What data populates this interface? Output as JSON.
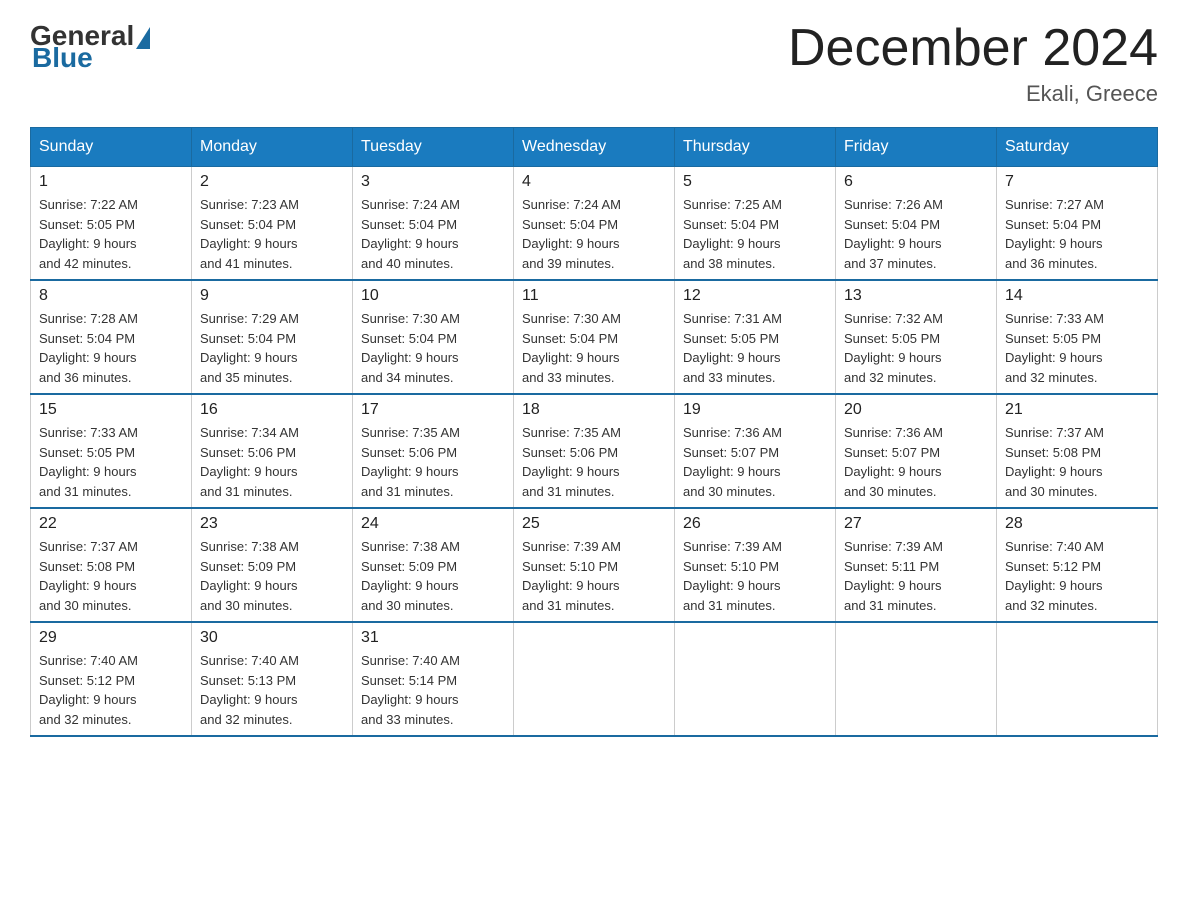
{
  "header": {
    "logo_general": "General",
    "logo_blue": "Blue",
    "title": "December 2024",
    "location": "Ekali, Greece"
  },
  "days_of_week": [
    "Sunday",
    "Monday",
    "Tuesday",
    "Wednesday",
    "Thursday",
    "Friday",
    "Saturday"
  ],
  "weeks": [
    [
      {
        "day": "1",
        "sunrise": "7:22 AM",
        "sunset": "5:05 PM",
        "daylight": "9 hours and 42 minutes."
      },
      {
        "day": "2",
        "sunrise": "7:23 AM",
        "sunset": "5:04 PM",
        "daylight": "9 hours and 41 minutes."
      },
      {
        "day": "3",
        "sunrise": "7:24 AM",
        "sunset": "5:04 PM",
        "daylight": "9 hours and 40 minutes."
      },
      {
        "day": "4",
        "sunrise": "7:24 AM",
        "sunset": "5:04 PM",
        "daylight": "9 hours and 39 minutes."
      },
      {
        "day": "5",
        "sunrise": "7:25 AM",
        "sunset": "5:04 PM",
        "daylight": "9 hours and 38 minutes."
      },
      {
        "day": "6",
        "sunrise": "7:26 AM",
        "sunset": "5:04 PM",
        "daylight": "9 hours and 37 minutes."
      },
      {
        "day": "7",
        "sunrise": "7:27 AM",
        "sunset": "5:04 PM",
        "daylight": "9 hours and 36 minutes."
      }
    ],
    [
      {
        "day": "8",
        "sunrise": "7:28 AM",
        "sunset": "5:04 PM",
        "daylight": "9 hours and 36 minutes."
      },
      {
        "day": "9",
        "sunrise": "7:29 AM",
        "sunset": "5:04 PM",
        "daylight": "9 hours and 35 minutes."
      },
      {
        "day": "10",
        "sunrise": "7:30 AM",
        "sunset": "5:04 PM",
        "daylight": "9 hours and 34 minutes."
      },
      {
        "day": "11",
        "sunrise": "7:30 AM",
        "sunset": "5:04 PM",
        "daylight": "9 hours and 33 minutes."
      },
      {
        "day": "12",
        "sunrise": "7:31 AM",
        "sunset": "5:05 PM",
        "daylight": "9 hours and 33 minutes."
      },
      {
        "day": "13",
        "sunrise": "7:32 AM",
        "sunset": "5:05 PM",
        "daylight": "9 hours and 32 minutes."
      },
      {
        "day": "14",
        "sunrise": "7:33 AM",
        "sunset": "5:05 PM",
        "daylight": "9 hours and 32 minutes."
      }
    ],
    [
      {
        "day": "15",
        "sunrise": "7:33 AM",
        "sunset": "5:05 PM",
        "daylight": "9 hours and 31 minutes."
      },
      {
        "day": "16",
        "sunrise": "7:34 AM",
        "sunset": "5:06 PM",
        "daylight": "9 hours and 31 minutes."
      },
      {
        "day": "17",
        "sunrise": "7:35 AM",
        "sunset": "5:06 PM",
        "daylight": "9 hours and 31 minutes."
      },
      {
        "day": "18",
        "sunrise": "7:35 AM",
        "sunset": "5:06 PM",
        "daylight": "9 hours and 31 minutes."
      },
      {
        "day": "19",
        "sunrise": "7:36 AM",
        "sunset": "5:07 PM",
        "daylight": "9 hours and 30 minutes."
      },
      {
        "day": "20",
        "sunrise": "7:36 AM",
        "sunset": "5:07 PM",
        "daylight": "9 hours and 30 minutes."
      },
      {
        "day": "21",
        "sunrise": "7:37 AM",
        "sunset": "5:08 PM",
        "daylight": "9 hours and 30 minutes."
      }
    ],
    [
      {
        "day": "22",
        "sunrise": "7:37 AM",
        "sunset": "5:08 PM",
        "daylight": "9 hours and 30 minutes."
      },
      {
        "day": "23",
        "sunrise": "7:38 AM",
        "sunset": "5:09 PM",
        "daylight": "9 hours and 30 minutes."
      },
      {
        "day": "24",
        "sunrise": "7:38 AM",
        "sunset": "5:09 PM",
        "daylight": "9 hours and 30 minutes."
      },
      {
        "day": "25",
        "sunrise": "7:39 AM",
        "sunset": "5:10 PM",
        "daylight": "9 hours and 31 minutes."
      },
      {
        "day": "26",
        "sunrise": "7:39 AM",
        "sunset": "5:10 PM",
        "daylight": "9 hours and 31 minutes."
      },
      {
        "day": "27",
        "sunrise": "7:39 AM",
        "sunset": "5:11 PM",
        "daylight": "9 hours and 31 minutes."
      },
      {
        "day": "28",
        "sunrise": "7:40 AM",
        "sunset": "5:12 PM",
        "daylight": "9 hours and 32 minutes."
      }
    ],
    [
      {
        "day": "29",
        "sunrise": "7:40 AM",
        "sunset": "5:12 PM",
        "daylight": "9 hours and 32 minutes."
      },
      {
        "day": "30",
        "sunrise": "7:40 AM",
        "sunset": "5:13 PM",
        "daylight": "9 hours and 32 minutes."
      },
      {
        "day": "31",
        "sunrise": "7:40 AM",
        "sunset": "5:14 PM",
        "daylight": "9 hours and 33 minutes."
      },
      null,
      null,
      null,
      null
    ]
  ],
  "labels": {
    "sunrise": "Sunrise:",
    "sunset": "Sunset:",
    "daylight": "Daylight:"
  }
}
